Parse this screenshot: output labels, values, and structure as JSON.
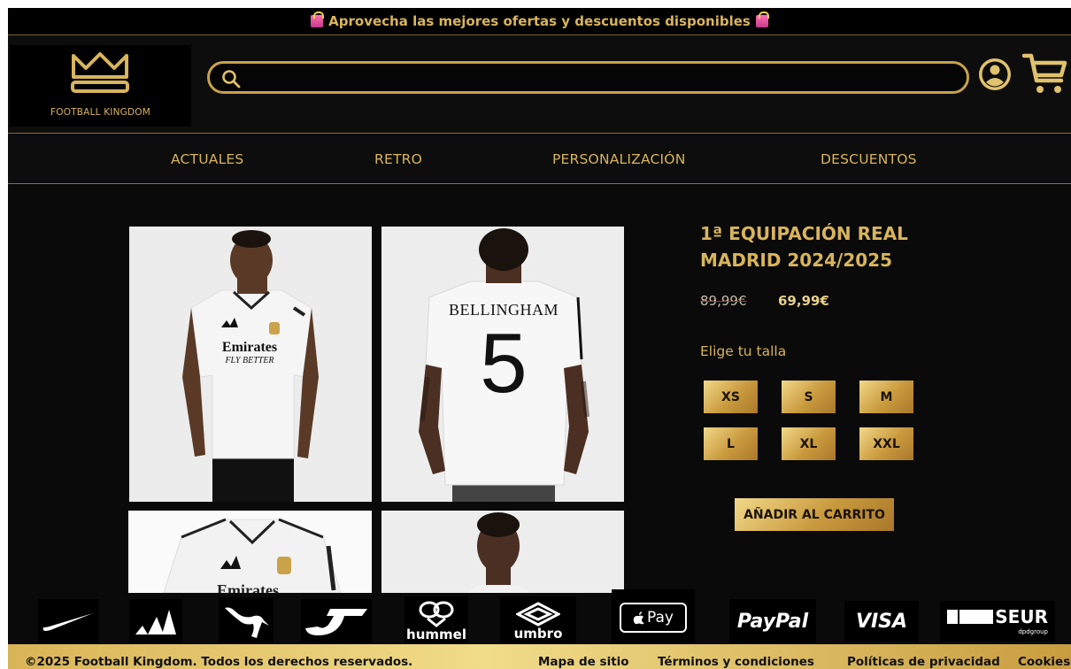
{
  "announcement": {
    "text": "Aprovecha las mejores ofertas y descuentos disponibles",
    "icon": "shopping-bag-icon"
  },
  "header": {
    "logo_text": "FOOTBALL KINGDOM",
    "search": {
      "placeholder": "",
      "value": ""
    }
  },
  "nav": {
    "items": [
      {
        "label": "ACTUALES"
      },
      {
        "label": "RETRO"
      },
      {
        "label": "PERSONALIZACIÓN"
      },
      {
        "label": "DESCUENTOS"
      }
    ]
  },
  "product": {
    "title_line1": "1ª EQUIPACIÓN REAL",
    "title_line2": "MADRID 2024/2025",
    "old_price": "89,99€",
    "price": "69,99€",
    "size_label": "Elige tu talla",
    "sizes": [
      "XS",
      "S",
      "M",
      "L",
      "XL",
      "XXL"
    ],
    "add_to_cart": "AÑADIR AL CARRITO",
    "gallery": {
      "front": {
        "sponsor": "Emirates",
        "sponsor_sub": "FLY BETTER"
      },
      "back": {
        "player_name": "BELLINGHAM",
        "number": "5"
      },
      "detail": {
        "sponsor": "Emirates"
      }
    }
  },
  "brands": {
    "hummel": "hummel",
    "umbro": "umbro",
    "apple_pay": "Pay",
    "paypal": "PayPal",
    "visa": "VISA",
    "seur": "SEUR",
    "seur_sub": "dpdgroup"
  },
  "footer": {
    "copyright": "©2025 Football Kingdom. Todos los derechos reservados.",
    "sitemap": "Mapa de sitio",
    "terms": "Términos y condiciones",
    "privacy": "Políticas de privacidad",
    "cookies": "Cookies"
  },
  "colors": {
    "gold": "#d8b45c",
    "background": "#0a0a0a",
    "footer_gold": "#e8c96e"
  }
}
